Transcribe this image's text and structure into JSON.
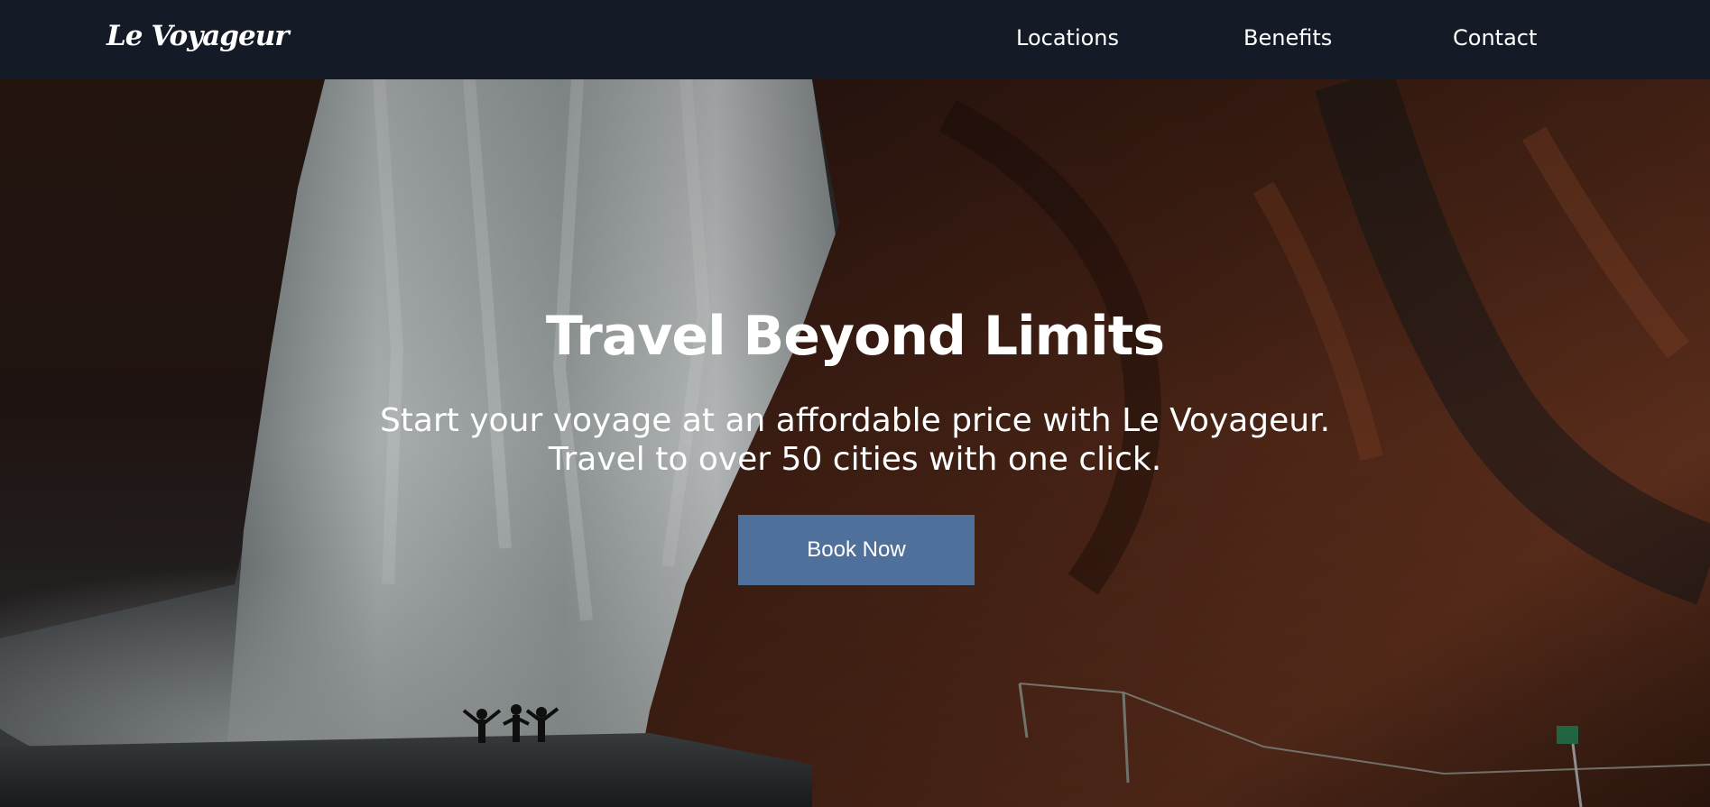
{
  "navbar": {
    "logo": "Le Voyageur",
    "links": [
      {
        "label": "Locations"
      },
      {
        "label": "Benefits"
      },
      {
        "label": "Contact"
      }
    ],
    "background_color": "#141b27"
  },
  "hero": {
    "title": "Travel Beyond Limits",
    "subtitle_line1": "Start your voyage at an affordable price with Le Voyageur.",
    "subtitle_line2": "Travel to over 50 cities with one click.",
    "cta_label": "Book Now",
    "cta_color": "#50709c",
    "background_image": "waterfall-cliff-photo"
  }
}
